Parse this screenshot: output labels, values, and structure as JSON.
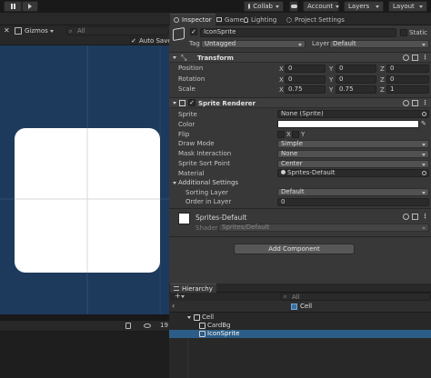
{
  "toolbar": {
    "play_icon": "pause-icon",
    "collab_label": "Collab",
    "account_label": "Account",
    "layers_label": "Layers",
    "layout_label": "Layout"
  },
  "scene": {
    "gizmos_label": "Gizmos",
    "search_placeholder": "All",
    "auto_save_label": "Auto Save",
    "auto_save_checked": true,
    "bottom_count": "19"
  },
  "inspector": {
    "tabs": [
      {
        "label": "Inspector",
        "icon": "info-icon",
        "active": true
      },
      {
        "label": "Game",
        "icon": "game-icon",
        "active": false
      },
      {
        "label": "Lighting",
        "icon": "bulb-icon",
        "active": false
      },
      {
        "label": "Project Settings",
        "icon": "gear-icon",
        "active": false
      }
    ],
    "object_name": "IconSprite",
    "static_label": "Static",
    "tag_label": "Tag",
    "tag_value": "Untagged",
    "layer_label": "Layer",
    "layer_value": "Default",
    "transform": {
      "title": "Transform",
      "position_label": "Position",
      "rotation_label": "Rotation",
      "scale_label": "Scale",
      "position": {
        "x": "0",
        "y": "0",
        "z": "0"
      },
      "rotation": {
        "x": "0",
        "y": "0",
        "z": "0"
      },
      "scale": {
        "x": "0.75",
        "y": "0.75",
        "z": "1"
      }
    },
    "sprite_renderer": {
      "title": "Sprite Renderer",
      "sprite_label": "Sprite",
      "sprite_value": "None (Sprite)",
      "color_label": "Color",
      "color_value": "#ffffff",
      "flip_label": "Flip",
      "flip_x": "X",
      "flip_y": "Y",
      "draw_mode_label": "Draw Mode",
      "draw_mode_value": "Simple",
      "mask_label": "Mask Interaction",
      "mask_value": "None",
      "sort_point_label": "Sprite Sort Point",
      "sort_point_value": "Center",
      "material_label": "Material",
      "material_value": "Sprites-Default",
      "additional_label": "Additional Settings",
      "sorting_layer_label": "Sorting Layer",
      "sorting_layer_value": "Default",
      "order_label": "Order in Layer",
      "order_value": "0"
    },
    "material_block": {
      "name": "Sprites-Default",
      "shader_label": "Shader",
      "shader_value": "Sprites/Default"
    },
    "add_component_label": "Add Component"
  },
  "hierarchy": {
    "tab_label": "Hierarchy",
    "search_placeholder": "All",
    "scene_name": "Cell",
    "items": [
      {
        "label": "Cell",
        "depth": 0,
        "expanded": true,
        "selected": false
      },
      {
        "label": "CardBg",
        "depth": 1,
        "expanded": false,
        "selected": false
      },
      {
        "label": "IconSprite",
        "depth": 1,
        "expanded": false,
        "selected": true
      }
    ]
  },
  "colors": {
    "scene_bg": "#1d3a5c",
    "selection": "#2c5d87",
    "panel": "#383838"
  }
}
